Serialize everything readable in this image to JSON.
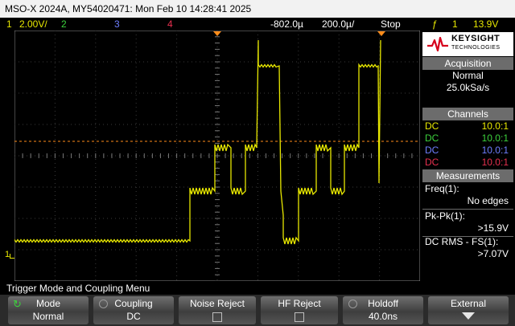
{
  "title": "MSO-X 2024A, MY54020471: Mon Feb 10 14:28:41 2025",
  "status": {
    "ch1_num": "1",
    "ch1_scale": "2.00V/",
    "ch2_num": "2",
    "ch3_num": "3",
    "ch4_num": "4",
    "time_delay": "-802.0µ",
    "time_scale": "200.0µ/",
    "run_state": "Stop",
    "trigger_symbol": "ƒ",
    "trigger_channel": "1",
    "trigger_level": "13.9V"
  },
  "brand": {
    "name": "KEYSIGHT",
    "sub": "TECHNOLOGIES"
  },
  "acquisition": {
    "header": "Acquisition",
    "mode": "Normal",
    "rate": "25.0kSa/s"
  },
  "channels": {
    "header": "Channels",
    "rows": [
      {
        "coupling": "DC",
        "probe": "10.0:1",
        "color": "#e8e800"
      },
      {
        "coupling": "DC",
        "probe": "10.0:1",
        "color": "#3cd13c"
      },
      {
        "coupling": "DC",
        "probe": "10.0:1",
        "color": "#6f7fff"
      },
      {
        "coupling": "DC",
        "probe": "10.0:1",
        "color": "#e8304f"
      }
    ]
  },
  "measurements": {
    "header": "Measurements",
    "items": [
      {
        "label": "Freq(1):",
        "value": "No edges"
      },
      {
        "label": "Pk-Pk(1):",
        "value": ">15.9V"
      },
      {
        "label": "DC RMS - FS(1):",
        "value": ">7.07V"
      }
    ]
  },
  "menu_title": "Trigger Mode and Coupling Menu",
  "softkeys": [
    {
      "title": "Mode",
      "value": "Normal"
    },
    {
      "title": "Coupling",
      "value": "DC"
    },
    {
      "title": "Noise Reject",
      "value": ""
    },
    {
      "title": "HF Reject",
      "value": ""
    },
    {
      "title": "Holdoff",
      "value": "40.0ns"
    },
    {
      "title": "External",
      "value": ""
    }
  ],
  "markers": {
    "ground": "1",
    "ground_color": "#e8e800",
    "trigger_color": "#ff8c1a",
    "trace_color": "#e8e800"
  }
}
